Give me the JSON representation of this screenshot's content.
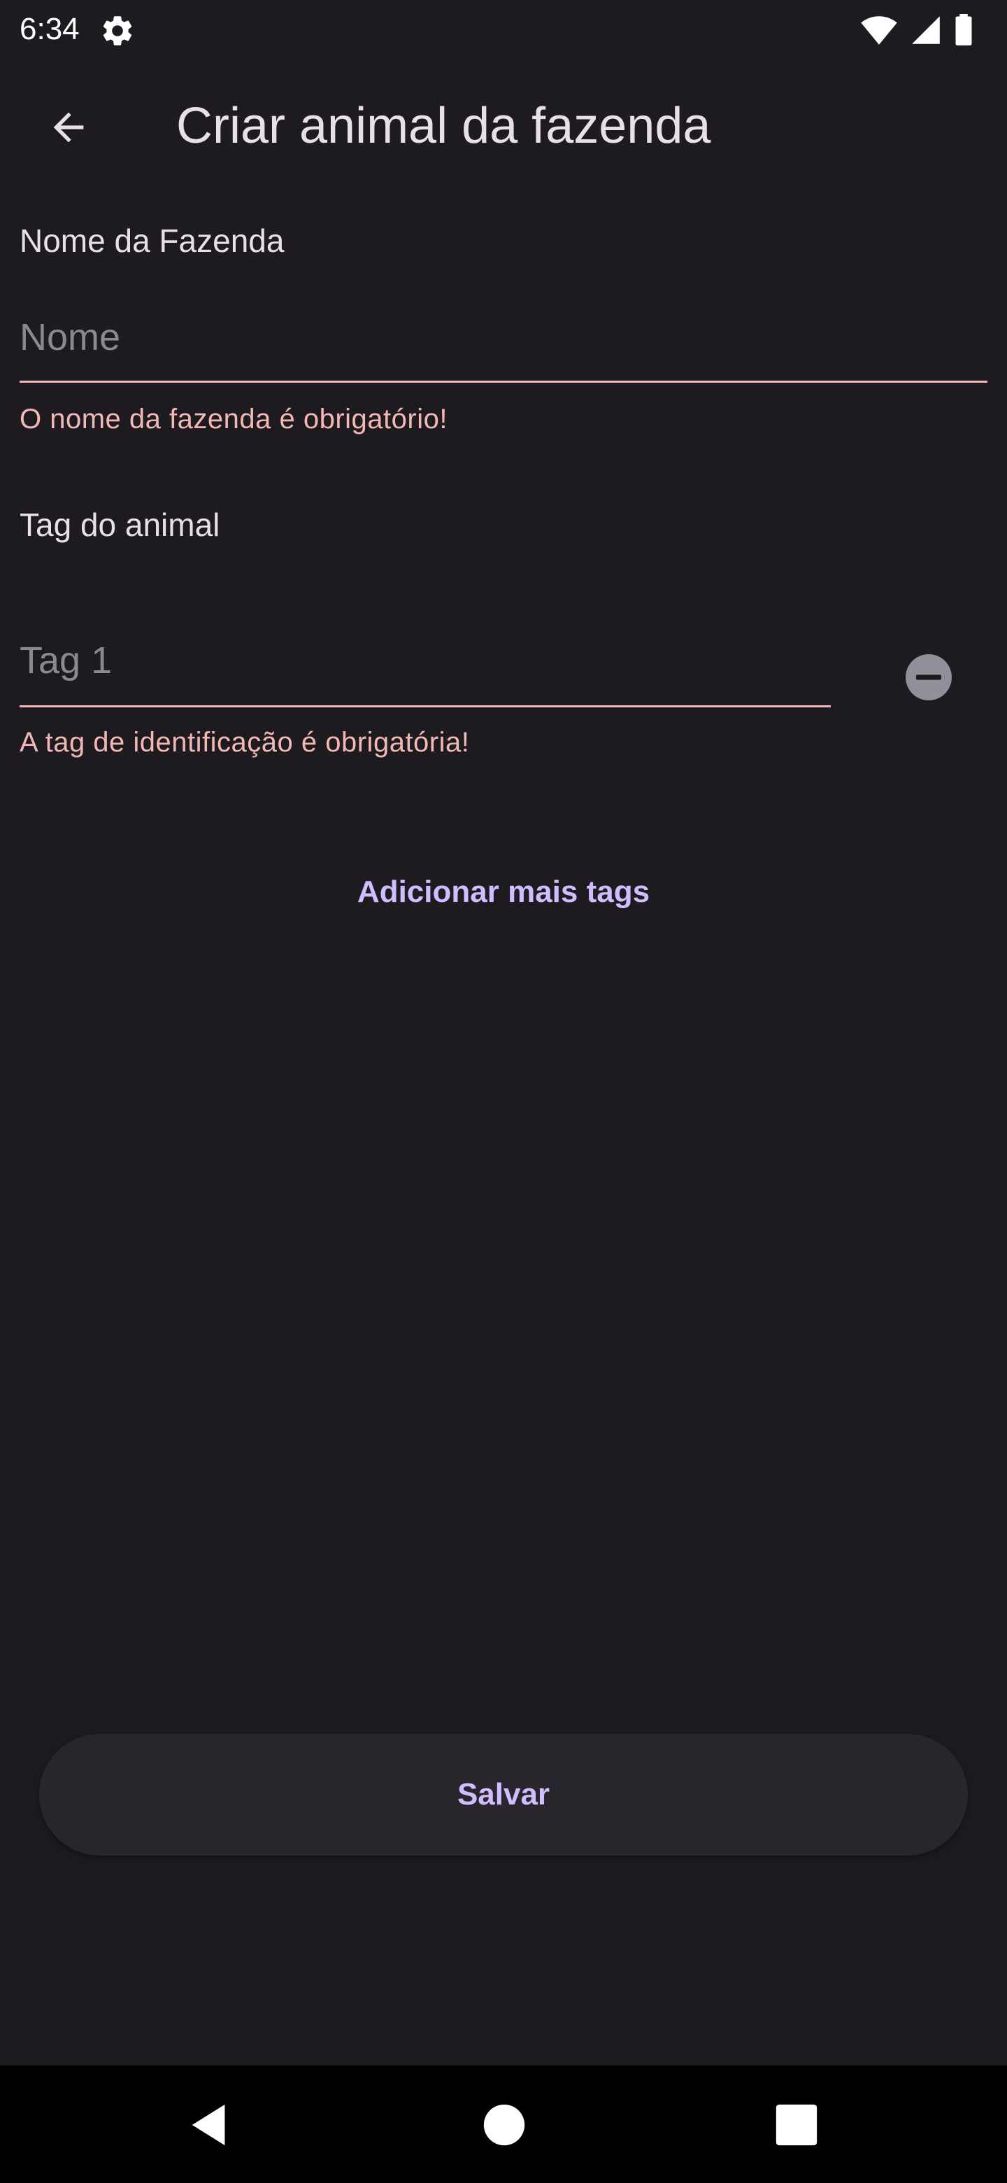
{
  "status_bar": {
    "time": "6:34",
    "icons": [
      "settings-gear-icon",
      "wifi-icon",
      "signal-icon",
      "battery-icon"
    ]
  },
  "app_bar": {
    "title": "Criar animal da fazenda",
    "back_icon": "arrow-back-icon"
  },
  "form": {
    "farm_name": {
      "label": "Nome da Fazenda",
      "placeholder": "Nome",
      "value": "",
      "error": "O nome da fazenda é obrigatório!"
    },
    "animal_tag": {
      "label": "Tag do animal",
      "tags": [
        {
          "placeholder": "Tag 1",
          "value": "",
          "error": "A tag de identificação é obrigatória!",
          "remove_icon": "remove-circle-icon"
        }
      ]
    },
    "add_tags_label": "Adicionar mais tags",
    "save_label": "Salvar"
  },
  "nav_bar": {
    "icons": [
      "back-triangle-icon",
      "home-circle-icon",
      "recents-square-icon"
    ]
  },
  "colors": {
    "background": "#1d1b20",
    "error": "#f2b8b5",
    "primary": "#d0bcff"
  }
}
